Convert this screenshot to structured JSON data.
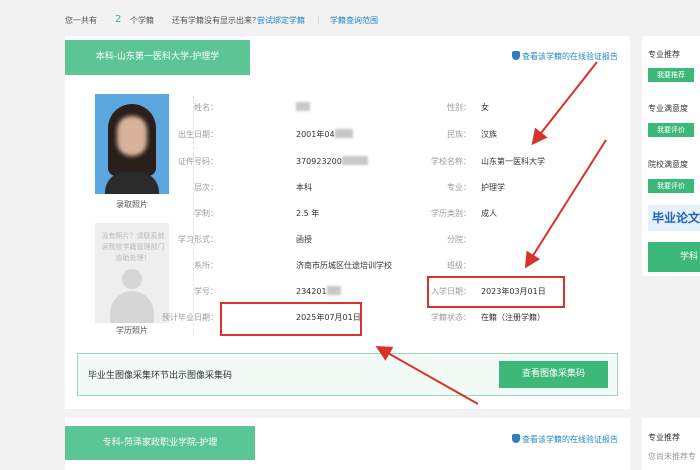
{
  "summary": {
    "prefix": "您一共有",
    "count": "2",
    "suffix": "个学籍",
    "missing_q": "还有学籍没有显示出来？",
    "bind_link": "尝试绑定学籍",
    "sep": "|",
    "scope_link": "学籍查询范围"
  },
  "record1": {
    "ribbon": "本科-山东第一医科大学-护理学",
    "verify_link": "查看该学籍的在线验证报告",
    "photo_caption": "录取照片",
    "placeholder_text": "没有照片？请联系就读院校学籍管理部门协助处理！",
    "photo2_caption": "学历照片",
    "fields": {
      "name_label": "姓名：",
      "name_value": "",
      "gender_label": "性别：",
      "gender_value": "女",
      "birth_label": "出生日期：",
      "birth_value": "2001年04",
      "ethnicity_label": "民族：",
      "ethnicity_value": "汉族",
      "id_label": "证件号码：",
      "id_value": "370923200",
      "school_label": "学校名称：",
      "school_value": "山东第一医科大学",
      "level_label": "层次：",
      "level_value": "本科",
      "major_label": "专业：",
      "major_value": "护理学",
      "duration_label": "学制：",
      "duration_value": "2.5 年",
      "category_label": "学历类别：",
      "category_value": "成人",
      "form_label": "学习形式：",
      "form_value": "函授",
      "branch_label": "分院：",
      "branch_value": "",
      "dept_label": "系所：",
      "dept_value": "济南市历城区仕途培训学校",
      "class_label": "班级：",
      "class_value": "",
      "stuno_label": "学号：",
      "stuno_value": "234201",
      "enroll_label": "入学日期：",
      "enroll_value": "2023年03月01日",
      "grad_label": "预计毕业日期：",
      "grad_value": "2025年07月01日",
      "status_label": "学籍状态：",
      "status_value": "在籍（注册学籍）"
    },
    "banner_text": "毕业生图像采集环节出示图像采集码",
    "banner_button": "查看图像采集码"
  },
  "record2": {
    "ribbon": "专科-菏泽家政职业学院-护理",
    "verify_link": "查看该学籍的在线验证报告"
  },
  "right_panel": {
    "s1_title": "专业推荐",
    "s1_btn": "我要推荐",
    "s2_title": "专业满意度",
    "s2_btn": "我要评价",
    "s3_title": "院校满意度",
    "s3_btn": "我要评价",
    "paper_text": "毕业论文",
    "paper_btn": "学科",
    "s4_title": "专业推荐",
    "s4_text": "您尚未推荐专"
  },
  "colors": {
    "accent": "#3cb878",
    "link": "#1e88c7",
    "highlight": "#d9322b"
  }
}
